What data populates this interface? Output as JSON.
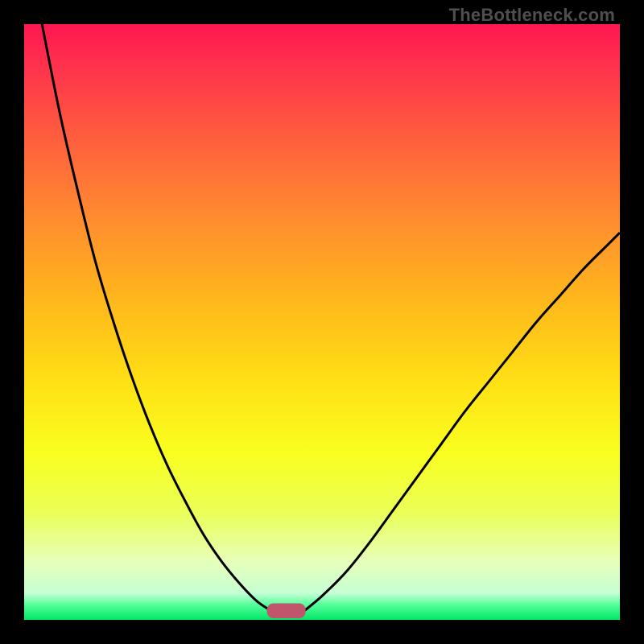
{
  "watermark": "TheBottleneck.com",
  "chart_data": {
    "type": "line",
    "title": "",
    "xlabel": "",
    "ylabel": "",
    "xlim": [
      0,
      100
    ],
    "ylim": [
      0,
      100
    ],
    "series": [
      {
        "name": "left-curve",
        "x": [
          3,
          6,
          9,
          12,
          15,
          18,
          21,
          24,
          27,
          30,
          33,
          36,
          39,
          41.5
        ],
        "y": [
          100,
          85,
          72,
          60,
          50,
          41,
          33,
          26,
          20,
          14.5,
          10,
          6.3,
          3.2,
          1.5
        ]
      },
      {
        "name": "right-curve",
        "x": [
          47,
          50,
          54,
          58,
          62,
          66,
          70,
          74,
          78,
          82,
          86,
          90,
          94,
          98,
          100
        ],
        "y": [
          1.5,
          4,
          8,
          13,
          18.5,
          24,
          29.5,
          35,
          40,
          45,
          50,
          54.5,
          59,
          63,
          65
        ]
      }
    ],
    "marker": {
      "name": "optimal-band",
      "x_center": 44,
      "width": 6.5,
      "height": 2.5,
      "color": "#c1556b"
    },
    "gradient_stops": [
      {
        "offset": 0.0,
        "color": "#ff1750"
      },
      {
        "offset": 0.06,
        "color": "#ff2e4e"
      },
      {
        "offset": 0.18,
        "color": "#ff5a3f"
      },
      {
        "offset": 0.32,
        "color": "#ff8a30"
      },
      {
        "offset": 0.46,
        "color": "#ffb61c"
      },
      {
        "offset": 0.6,
        "color": "#ffe015"
      },
      {
        "offset": 0.72,
        "color": "#f9ff1f"
      },
      {
        "offset": 0.82,
        "color": "#eaff58"
      },
      {
        "offset": 0.9,
        "color": "#e7ffb8"
      },
      {
        "offset": 0.955,
        "color": "#c6ffd4"
      },
      {
        "offset": 0.975,
        "color": "#54ff9a"
      },
      {
        "offset": 1.0,
        "color": "#00e765"
      }
    ]
  }
}
